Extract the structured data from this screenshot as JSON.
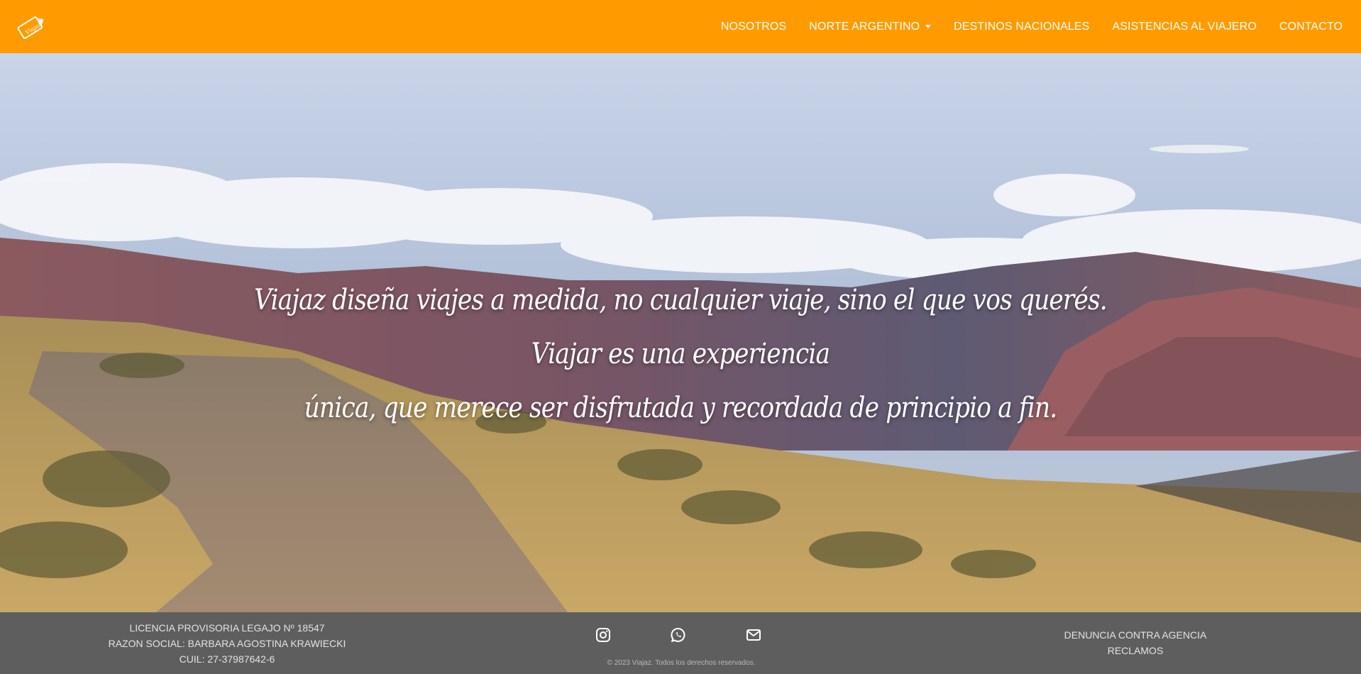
{
  "brand": {
    "logo_text": "Viajaz"
  },
  "nav": {
    "items": [
      {
        "label": "NOSOTROS"
      },
      {
        "label": "NORTE ARGENTINO",
        "dropdown": true
      },
      {
        "label": "DESTINOS NACIONALES"
      },
      {
        "label": "ASISTENCIAS AL VIAJERO"
      },
      {
        "label": "CONTACTO"
      }
    ]
  },
  "hero": {
    "line1": "Viajaz diseña viajes a medida, no cualquier viaje, sino el que vos querés. Viajar es una experiencia",
    "line2": "única, que merece ser disfrutada y recordada de principio a fin."
  },
  "footer": {
    "license": "LICENCIA PROVISORIA LEGAJO Nº 18547",
    "razon_social": "RAZON SOCIAL: BARBARA AGOSTINA KRAWIECKI",
    "cuil": "CUIL: 27-37987642-6",
    "social_icons": [
      "instagram-icon",
      "whatsapp-icon",
      "envelope-icon"
    ],
    "copyright": "© 2023 Viajaz. Todos los derechos reservados.",
    "links": [
      "DENUNCIA CONTRA AGENCIA",
      "RECLAMOS"
    ]
  },
  "colors": {
    "navbar": "#ff9b00",
    "footer": "#5e5e5e",
    "nav_text": "#ffffff"
  }
}
